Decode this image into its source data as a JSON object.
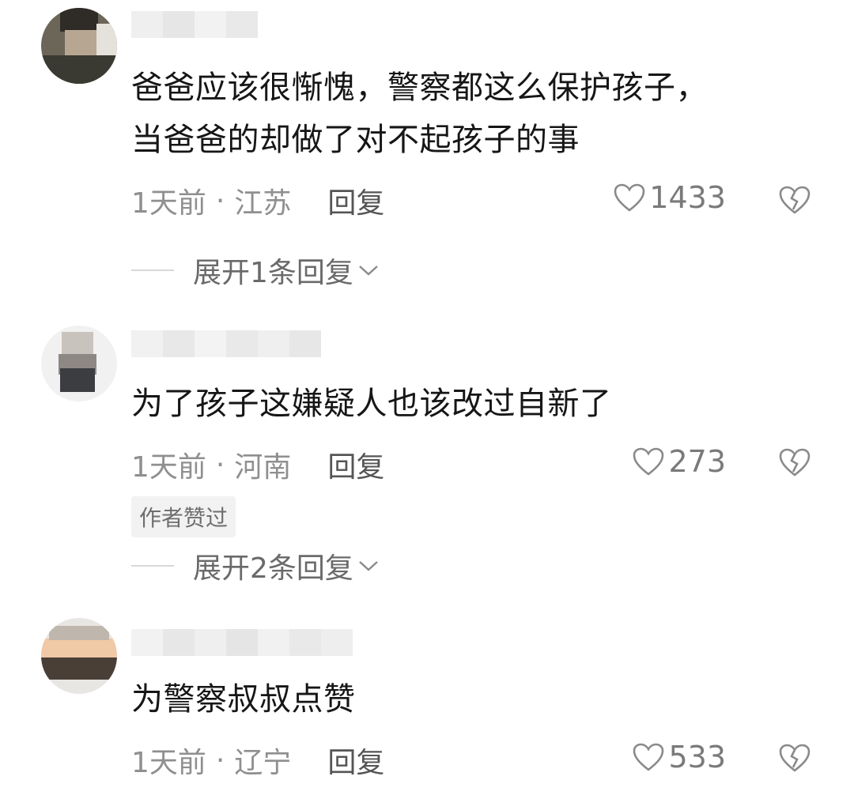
{
  "comments": [
    {
      "text_lines": [
        "爸爸应该很惭愧，警察都这么保护孩子，",
        "当爸爸的却做了对不起孩子的事"
      ],
      "time": "1天前",
      "sep": "·",
      "location": "江苏",
      "reply_label": "回复",
      "likes": "1433",
      "expand_label": "展开1条回复"
    },
    {
      "text_lines": [
        "为了孩子这嫌疑人也该改过自新了"
      ],
      "time": "1天前",
      "sep": "·",
      "location": "河南",
      "reply_label": "回复",
      "likes": "273",
      "badge": "作者赞过",
      "expand_label": "展开2条回复"
    },
    {
      "text_lines": [
        "为警察叔叔点赞"
      ],
      "time": "1天前",
      "sep": "·",
      "location": "辽宁",
      "reply_label": "回复",
      "likes": "533"
    }
  ],
  "icons": {
    "like": "heart-outline-icon",
    "dislike": "broken-heart-icon",
    "expand": "chevron-down-icon"
  },
  "colors": {
    "text": "#161616",
    "meta": "#8f8f8f",
    "badge_bg": "#f2f2f2"
  }
}
